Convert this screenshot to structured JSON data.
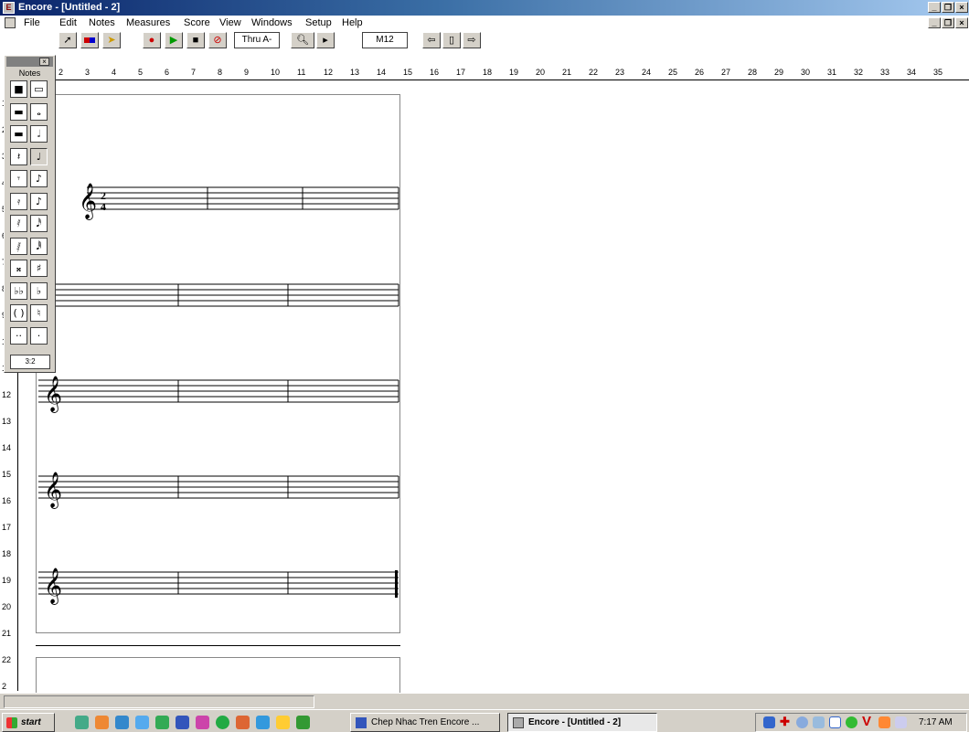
{
  "window": {
    "title": "Encore - [Untitled - 2]"
  },
  "menubar": {
    "items": [
      "File",
      "Edit",
      "Notes",
      "Measures",
      "Score",
      "View",
      "Windows",
      "Setup",
      "Help"
    ]
  },
  "toolbar": {
    "thru_label": "Thru A-",
    "measure_label": "M12"
  },
  "palette": {
    "title": "Notes",
    "tuplet": "3:2"
  },
  "ruler": {
    "h_ticks": [
      "2",
      "3",
      "4",
      "5",
      "6",
      "7",
      "8",
      "9",
      "10",
      "11",
      "12",
      "13",
      "14",
      "15",
      "16",
      "17",
      "18",
      "19",
      "20",
      "21",
      "22",
      "23",
      "24",
      "25",
      "26",
      "27",
      "28",
      "29",
      "30",
      "31",
      "32",
      "33",
      "34",
      "35"
    ],
    "v_ticks": [
      "1",
      "2",
      "3",
      "4",
      "5",
      "6",
      "7",
      "8",
      "9",
      "1",
      "1",
      "12",
      "13",
      "14",
      "15",
      "16",
      "17",
      "18",
      "19",
      "20",
      "21",
      "22",
      "2"
    ]
  },
  "score": {
    "time_signature_top": "2",
    "time_signature_bottom": "4",
    "clef": "𝄞"
  },
  "taskbar": {
    "start_label": "start",
    "tasks": [
      "Chep Nhac Tren Encore ...",
      "Encore - [Untitled - 2]"
    ],
    "clock": "7:17 AM"
  },
  "colors": {
    "title_start": "#0a246a",
    "title_end": "#a6caf0",
    "chrome": "#d4d0c8"
  }
}
